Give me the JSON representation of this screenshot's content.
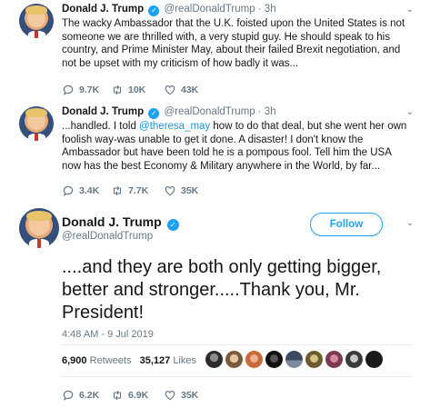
{
  "tweets": [
    {
      "name": "Donald J. Trump",
      "handle": "@realDonaldTrump · 3h",
      "text": "The wacky Ambassador that the U.K. foisted upon the United States is not someone we are thrilled with, a very stupid guy. He should speak to his country, and Prime Minister May, about their failed Brexit negotiation, and not be upset with my criticism of how badly it was...",
      "replies": "9.7K",
      "retweets": "10K",
      "likes": "43K"
    },
    {
      "name": "Donald J. Trump",
      "handle": "@realDonaldTrump · 3h",
      "text_pre": "...handled. I told ",
      "mention": "@theresa_may",
      "text_post": " how to do that deal, but she went her own foolish way-was unable to get it done. A disaster! I don't know the Ambassador but have been told he is a pompous fool. Tell him the USA now has the best Economy & Military  anywhere in the World, by far...",
      "replies": "3.4K",
      "retweets": "7.7K",
      "likes": "35K"
    }
  ],
  "main_tweet": {
    "name": "Donald J. Trump",
    "handle": "@realDonaldTrump",
    "follow_label": "Follow",
    "text": "....and they are both only getting bigger, better and stronger.....Thank you, Mr. President!",
    "timestamp": "4:48 AM - 9 Jul 2019",
    "retweet_count": "6,900",
    "retweet_label": "Retweets",
    "like_count": "35,127",
    "like_label": "Likes",
    "replies": "6.2K",
    "retweets": "6.9K",
    "likes": "35K"
  },
  "colors": {
    "accent": "#1da1f2",
    "text": "#14171a",
    "muted": "#657786"
  }
}
